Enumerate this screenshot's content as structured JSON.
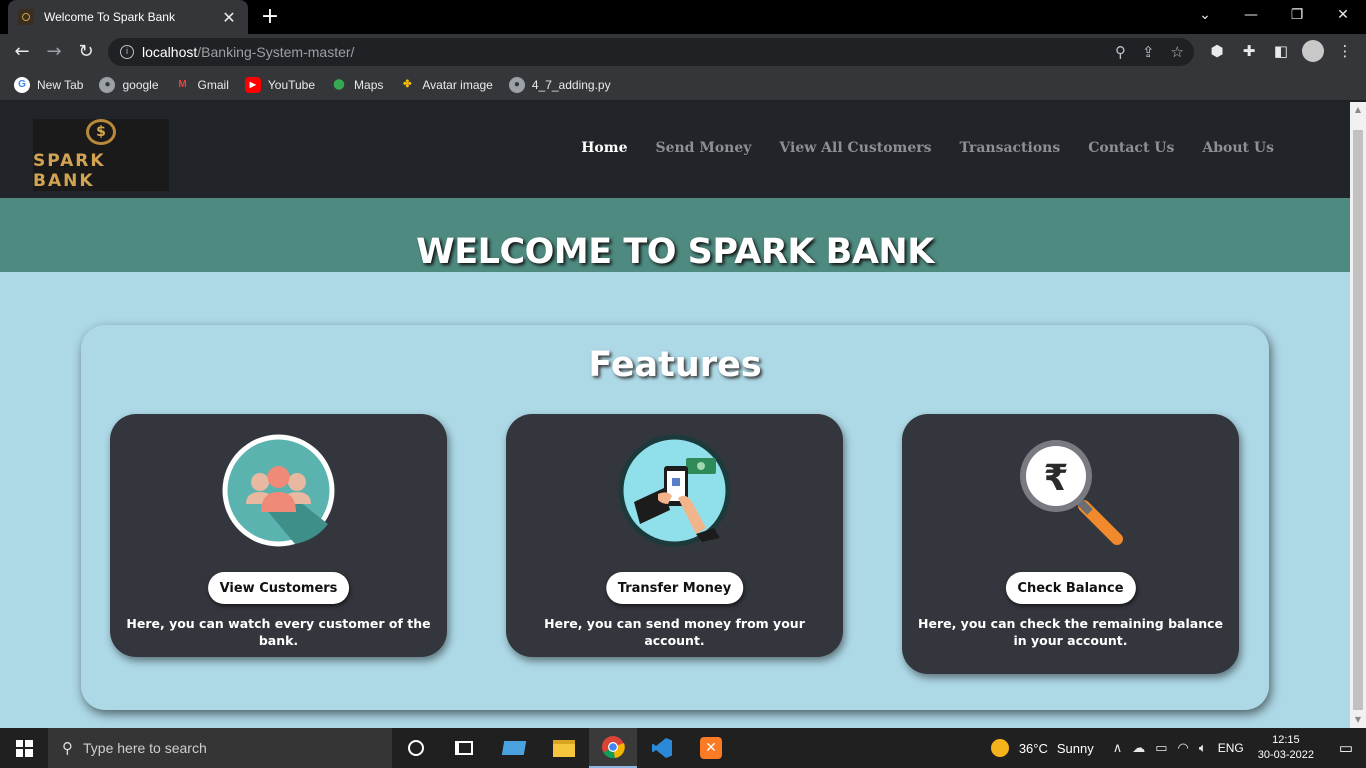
{
  "browser": {
    "tab_title": "Welcome To Spark Bank",
    "tab_close": "✕",
    "new_tab": "+",
    "url_host": "localhost",
    "url_path": "/Banking-System-master/",
    "window_controls": [
      "⌄",
      "—",
      "❐",
      "✕"
    ],
    "bookmarks": [
      {
        "label": "New Tab",
        "icon": "google-icon",
        "color": "#4285f4"
      },
      {
        "label": "google",
        "icon": "globe-icon",
        "color": "#9aa0a6"
      },
      {
        "label": "Gmail",
        "icon": "gmail-icon",
        "color": "#ea4335"
      },
      {
        "label": "YouTube",
        "icon": "youtube-icon",
        "color": "#ff0000"
      },
      {
        "label": "Maps",
        "icon": "maps-icon",
        "color": "#34a853"
      },
      {
        "label": "Avatar image",
        "icon": "pinwheel-icon",
        "color": "#fbbc05"
      },
      {
        "label": "4_7_adding.py",
        "icon": "globe-icon",
        "color": "#9aa0a6"
      }
    ]
  },
  "site": {
    "logo_text": "SPARK BANK",
    "logo_symbol": "$",
    "nav": [
      {
        "label": "Home",
        "active": true
      },
      {
        "label": "Send Money",
        "active": false
      },
      {
        "label": "View All Customers",
        "active": false
      },
      {
        "label": "Transactions",
        "active": false
      },
      {
        "label": "Contact Us",
        "active": false
      },
      {
        "label": "About Us",
        "active": false
      }
    ],
    "hero_title": "WELCOME TO SPARK BANK",
    "features_title": "Features",
    "cards": [
      {
        "button": "View Customers",
        "description": "Here, you can watch every customer of the bank.",
        "icon": "customers-icon"
      },
      {
        "button": "Transfer Money",
        "description": "Here, you can send money from your account.",
        "icon": "mobile-transfer-icon"
      },
      {
        "button": "Check Balance",
        "description": "Here, you can check the remaining balance in your account.",
        "icon": "rupee-magnifier-icon"
      }
    ]
  },
  "taskbar": {
    "search_placeholder": "Type here to search",
    "weather_temp": "36°C",
    "weather_desc": "Sunny",
    "language": "ENG",
    "time": "12:15",
    "date": "30-03-2022"
  },
  "colors": {
    "nav_bg": "#212529",
    "hero_bg": "#4e8a80",
    "page_bg": "#add8e6",
    "card_bg": "#33363c"
  }
}
